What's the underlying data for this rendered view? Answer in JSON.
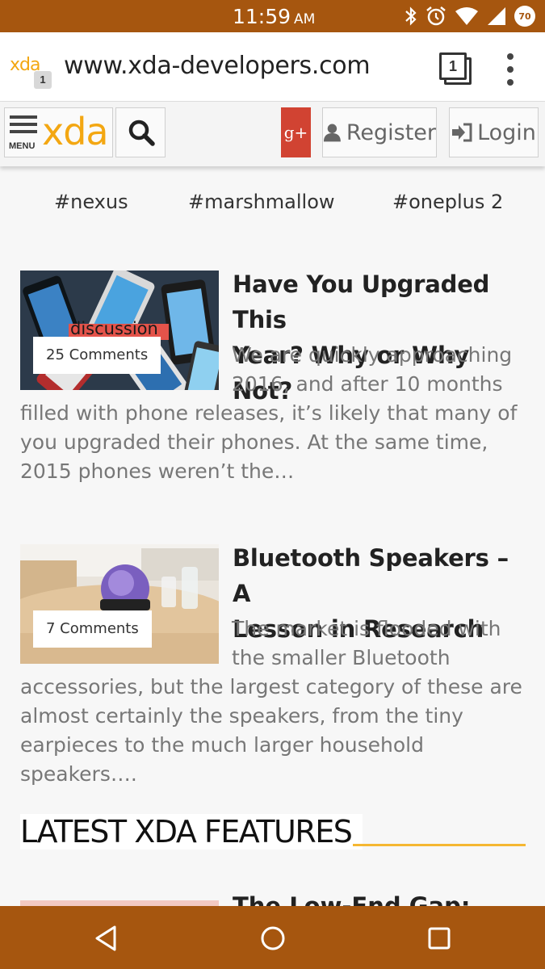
{
  "status_bar": {
    "time": "11:59",
    "ampm": "AM",
    "battery": "70",
    "icons": [
      "bluetooth-icon",
      "alarm-icon",
      "wifi-icon",
      "signal-icon",
      "battery-icon"
    ]
  },
  "browser": {
    "favicon_text": "xda",
    "tab_badge": "1",
    "url": "www.xda-developers.com",
    "tab_count": "1"
  },
  "site_header": {
    "menu_label": "MENU",
    "logo": "xda",
    "gplus": "g+",
    "register": "Register",
    "login": "Login",
    "colors": {
      "brand": "#f3a712",
      "gplus": "#d14332"
    }
  },
  "tags": [
    "#nexus",
    "#marshmallow",
    "#oneplus 2"
  ],
  "articles": [
    {
      "title": "Have You Upgraded This Year? Why or Why Not?",
      "title_line1": "Have You Upgraded This",
      "title_line2": "Year? Why or Why Not?",
      "comments": "25 Comments",
      "thumb_label": "discussion",
      "excerpt": "We are quickly approaching 2016, and after 10 months filled with phone releases, it’s likely that many of you upgraded their phones. At the same time, 2015 phones weren’t the…"
    },
    {
      "title": "Bluetooth Speakers – A Lesson in Research",
      "title_line1": "Bluetooth Speakers – A",
      "title_line2": "Lesson in Research",
      "comments": "7 Comments",
      "excerpt": "The market is flooded with the smaller Bluetooth accessories, but the largest category of these are almost certainly the speakers, from the tiny earpieces to the much larger household speakers…."
    }
  ],
  "section": {
    "title": "LATEST XDA FEATURES",
    "next_article_title": "The Low-End Gap: Quick"
  },
  "nav_bar": {
    "icons": [
      "back-icon",
      "home-icon",
      "recents-icon"
    ],
    "color": "#a6560f"
  }
}
